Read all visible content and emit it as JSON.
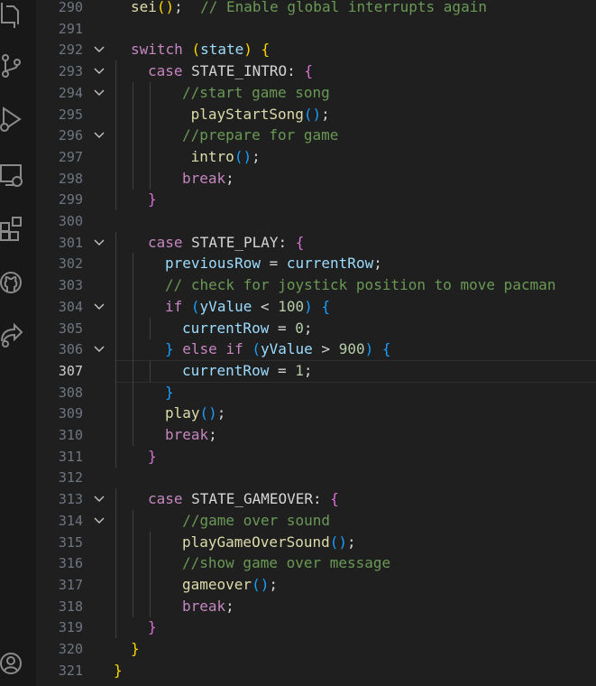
{
  "activity_icons": [
    "files-icon",
    "source-control-icon",
    "run-debug-icon",
    "remote-explorer-icon",
    "extensions-icon",
    "github-icon",
    "live-share-icon",
    "account-icon"
  ],
  "active_line": "307",
  "editor": {
    "lines": [
      {
        "num": "290",
        "fold": false,
        "indent": 1,
        "tokens": [
          [
            "sei",
            "fn"
          ],
          [
            "()",
            "p1"
          ],
          [
            ";  ",
            "op"
          ],
          [
            "// Enable global interrupts again",
            "cmt"
          ]
        ]
      },
      {
        "num": "291",
        "fold": false,
        "indent": 0,
        "tokens": []
      },
      {
        "num": "292",
        "fold": true,
        "indent": 1,
        "tokens": [
          [
            "switch",
            "kw"
          ],
          [
            " ",
            "txt"
          ],
          [
            "(",
            "p1"
          ],
          [
            "state",
            "var"
          ],
          [
            ")",
            "p1"
          ],
          [
            " ",
            "txt"
          ],
          [
            "{",
            "p1"
          ]
        ]
      },
      {
        "num": "293",
        "fold": true,
        "indent": 2,
        "tokens": [
          [
            "case",
            "kw"
          ],
          [
            " STATE_INTRO: ",
            "txt"
          ],
          [
            "{",
            "p2"
          ]
        ]
      },
      {
        "num": "294",
        "fold": true,
        "indent": 4,
        "tokens": [
          [
            "//start game song",
            "cmt"
          ]
        ]
      },
      {
        "num": "295",
        "fold": false,
        "indent": 4,
        "pre": " ",
        "tokens": [
          [
            "playStartSong",
            "fn"
          ],
          [
            "()",
            "p3"
          ],
          [
            ";",
            "op"
          ]
        ]
      },
      {
        "num": "296",
        "fold": true,
        "indent": 4,
        "tokens": [
          [
            "//prepare for game",
            "cmt"
          ]
        ]
      },
      {
        "num": "297",
        "fold": false,
        "indent": 4,
        "pre": " ",
        "tokens": [
          [
            "intro",
            "fn"
          ],
          [
            "()",
            "p3"
          ],
          [
            ";",
            "op"
          ]
        ]
      },
      {
        "num": "298",
        "fold": false,
        "indent": 4,
        "tokens": [
          [
            "break",
            "kw"
          ],
          [
            ";",
            "op"
          ]
        ]
      },
      {
        "num": "299",
        "fold": false,
        "indent": 2,
        "tokens": [
          [
            "}",
            "p2"
          ]
        ]
      },
      {
        "num": "300",
        "fold": false,
        "indent": 0,
        "tokens": []
      },
      {
        "num": "301",
        "fold": true,
        "indent": 2,
        "tokens": [
          [
            "case",
            "kw"
          ],
          [
            " STATE_PLAY: ",
            "txt"
          ],
          [
            "{",
            "p2"
          ]
        ]
      },
      {
        "num": "302",
        "fold": false,
        "indent": 3,
        "tokens": [
          [
            "previousRow",
            "var"
          ],
          [
            " = ",
            "op"
          ],
          [
            "currentRow",
            "var"
          ],
          [
            ";",
            "op"
          ]
        ]
      },
      {
        "num": "303",
        "fold": false,
        "indent": 3,
        "tokens": [
          [
            "// check for joystick position to move pacman",
            "cmt"
          ]
        ]
      },
      {
        "num": "304",
        "fold": true,
        "indent": 3,
        "tokens": [
          [
            "if",
            "kw"
          ],
          [
            " ",
            "txt"
          ],
          [
            "(",
            "p3"
          ],
          [
            "yValue",
            "var"
          ],
          [
            " < ",
            "op"
          ],
          [
            "100",
            "num"
          ],
          [
            ")",
            "p3"
          ],
          [
            " ",
            "txt"
          ],
          [
            "{",
            "p3"
          ]
        ]
      },
      {
        "num": "305",
        "fold": false,
        "indent": 4,
        "tokens": [
          [
            "currentRow",
            "var"
          ],
          [
            " = ",
            "op"
          ],
          [
            "0",
            "num"
          ],
          [
            ";",
            "op"
          ]
        ]
      },
      {
        "num": "306",
        "fold": true,
        "indent": 3,
        "tokens": [
          [
            "}",
            "p3"
          ],
          [
            " ",
            "txt"
          ],
          [
            "else",
            "kw"
          ],
          [
            " ",
            "txt"
          ],
          [
            "if",
            "kw"
          ],
          [
            " ",
            "txt"
          ],
          [
            "(",
            "p3"
          ],
          [
            "yValue",
            "var"
          ],
          [
            " > ",
            "op"
          ],
          [
            "900",
            "num"
          ],
          [
            ")",
            "p3"
          ],
          [
            " ",
            "txt"
          ],
          [
            "{",
            "p3"
          ]
        ]
      },
      {
        "num": "307",
        "fold": false,
        "indent": 4,
        "tokens": [
          [
            "currentRow",
            "var"
          ],
          [
            " = ",
            "op"
          ],
          [
            "1",
            "num"
          ],
          [
            ";",
            "op"
          ]
        ]
      },
      {
        "num": "308",
        "fold": false,
        "indent": 3,
        "tokens": [
          [
            "}",
            "p3"
          ]
        ]
      },
      {
        "num": "309",
        "fold": false,
        "indent": 3,
        "tokens": [
          [
            "play",
            "fn"
          ],
          [
            "()",
            "p3"
          ],
          [
            ";",
            "op"
          ]
        ]
      },
      {
        "num": "310",
        "fold": false,
        "indent": 3,
        "tokens": [
          [
            "break",
            "kw"
          ],
          [
            ";",
            "op"
          ]
        ]
      },
      {
        "num": "311",
        "fold": false,
        "indent": 2,
        "tokens": [
          [
            "}",
            "p2"
          ]
        ]
      },
      {
        "num": "312",
        "fold": false,
        "indent": 0,
        "tokens": []
      },
      {
        "num": "313",
        "fold": true,
        "indent": 2,
        "tokens": [
          [
            "case",
            "kw"
          ],
          [
            " STATE_GAMEOVER: ",
            "txt"
          ],
          [
            "{",
            "p2"
          ]
        ]
      },
      {
        "num": "314",
        "fold": true,
        "indent": 3,
        "pre": "  ",
        "tokens": [
          [
            "//game over sound",
            "cmt"
          ]
        ]
      },
      {
        "num": "315",
        "fold": false,
        "indent": 4,
        "tokens": [
          [
            "playGameOverSound",
            "fn"
          ],
          [
            "()",
            "p3"
          ],
          [
            ";",
            "op"
          ]
        ]
      },
      {
        "num": "316",
        "fold": false,
        "indent": 4,
        "tokens": [
          [
            "//show game over message",
            "cmt"
          ]
        ]
      },
      {
        "num": "317",
        "fold": false,
        "indent": 4,
        "tokens": [
          [
            "gameover",
            "fn"
          ],
          [
            "()",
            "p3"
          ],
          [
            ";",
            "op"
          ]
        ]
      },
      {
        "num": "318",
        "fold": false,
        "indent": 4,
        "tokens": [
          [
            "break",
            "kw"
          ],
          [
            ";",
            "op"
          ]
        ]
      },
      {
        "num": "319",
        "fold": false,
        "indent": 2,
        "tokens": [
          [
            "}",
            "p2"
          ]
        ]
      },
      {
        "num": "320",
        "fold": false,
        "indent": 1,
        "tokens": [
          [
            "}",
            "p1"
          ]
        ]
      },
      {
        "num": "321",
        "fold": false,
        "indent": 0,
        "tokens": [
          [
            "}",
            "p1"
          ]
        ]
      }
    ]
  }
}
